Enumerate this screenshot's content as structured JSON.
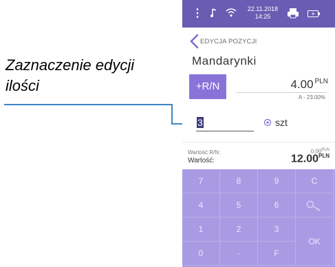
{
  "annotation": {
    "line1": "Zaznaczenie edycji",
    "line2": "ilości"
  },
  "status_bar": {
    "date": "22.11.2018",
    "time": "14:25",
    "color": "#6a5bb3"
  },
  "header": {
    "title": "EDYCJA POZYCJI"
  },
  "product": {
    "name": "Mandarynki"
  },
  "price": {
    "button_label": "+R/N",
    "value": "4.00",
    "currency": "PLN",
    "vat": "A - 23.00%"
  },
  "quantity": {
    "value": "3",
    "unit": "szt"
  },
  "summary": {
    "rn_label": "Wartość R/N:",
    "rn_value": "0.00",
    "rn_currency": "PLN",
    "total_label": "Wartość:",
    "total_value": "12.00",
    "total_currency": "PLN"
  },
  "keypad": {
    "keys": {
      "k7": "7",
      "k8": "8",
      "k9": "9",
      "c": "C",
      "k4": "4",
      "k5": "5",
      "k6": "6",
      "k1": "1",
      "k2": "2",
      "k3": "3",
      "ok": "OK",
      "k0": "0",
      "dot": "·",
      "f": "F"
    },
    "color": "#a99be3"
  }
}
